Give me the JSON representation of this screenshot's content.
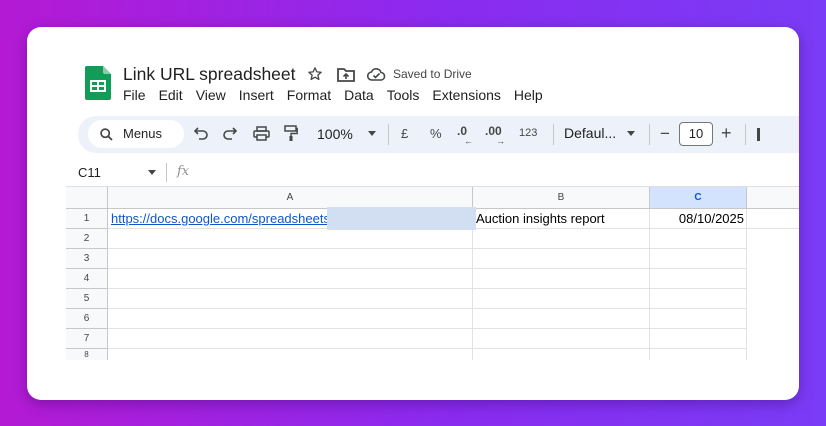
{
  "document": {
    "title": "Link URL spreadsheet",
    "save_status": "Saved to Drive"
  },
  "menu": [
    "File",
    "Edit",
    "View",
    "Insert",
    "Format",
    "Data",
    "Tools",
    "Extensions",
    "Help"
  ],
  "toolbar": {
    "search_label": "Menus",
    "zoom": "100%",
    "currency": "£",
    "percent": "%",
    "decrease_decimals": ".0",
    "increase_decimals": ".00",
    "number_format": "123",
    "font": "Defaul...",
    "font_size_minus": "−",
    "font_size": "10",
    "font_size_plus": "+"
  },
  "formula_bar": {
    "name_box": "C11",
    "fx": "fx"
  },
  "grid": {
    "columns": [
      "A",
      "B",
      "C"
    ],
    "selected_column": "C",
    "row_numbers": [
      "1",
      "2",
      "3",
      "4",
      "5",
      "6",
      "7",
      "8"
    ],
    "cells": {
      "A1": "https://docs.google.com/spreadsheets",
      "B1": "Auction insights report",
      "C1": "08/10/2025"
    }
  },
  "colors": {
    "link": "#1155cc",
    "toolbar_bg": "#edf2fa",
    "selected_header": "#d3e3fd",
    "sheets_green": "#0f9d58"
  }
}
